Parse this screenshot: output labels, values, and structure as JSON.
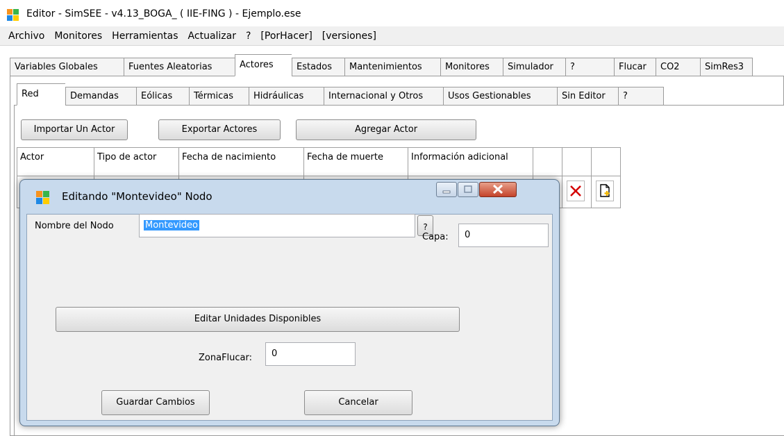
{
  "window": {
    "title": "Editor - SimSEE - v4.13_BOGA_ ( IIE-FING ) - Ejemplo.ese"
  },
  "menu": [
    "Archivo",
    "Monitores",
    "Herramientas",
    "Actualizar",
    "?",
    "[PorHacer]",
    "[versiones]"
  ],
  "outer_tabs": [
    "Variables Globales",
    "Fuentes Aleatorias",
    "Actores",
    "Estados",
    "Mantenimientos",
    "Monitores",
    "Simulador",
    "?",
    "Flucar",
    "CO2",
    "SimRes3"
  ],
  "outer_active_index": 2,
  "inner_tabs": [
    "Red",
    "Demandas",
    "Eólicas",
    "Térmicas",
    "Hidráulicas",
    "Internacional y Otros",
    "Usos Gestionables",
    "Sin Editor",
    "?"
  ],
  "inner_active_index": 0,
  "toolbar": {
    "import_label": "Importar Un Actor",
    "export_label": "Exportar Actores",
    "add_label": "Agregar Actor"
  },
  "grid": {
    "columns": [
      "Actor",
      "Tipo de actor",
      "Fecha de nacimiento",
      "Fecha de muerte",
      "Información adicional",
      "",
      "",
      ""
    ]
  },
  "dialog": {
    "title": "Editando \"Montevideo\" Nodo",
    "node_name_label": "Nombre del Nodo",
    "node_name_value": "Montevideo",
    "help_label": "?",
    "capa_label": "Capa:",
    "capa_value": "0",
    "edit_units_label": "Editar Unidades Disponibles",
    "zona_flucar_label": "ZonaFlucar:",
    "zona_flucar_value": "0",
    "save_label": "Guardar Cambios",
    "cancel_label": "Cancelar"
  },
  "colors": {
    "selection": "#3399ff",
    "dialog_frame": "#c8daed",
    "close_button": "#c4432a",
    "delete_icon": "#d40000",
    "icon_orange": "#f7931e",
    "icon_green": "#39b54a",
    "icon_blue": "#1e88e5",
    "icon_yellow": "#ffcc00"
  }
}
